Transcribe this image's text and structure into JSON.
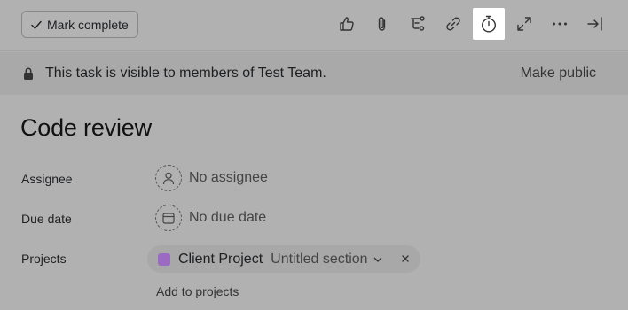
{
  "toolbar": {
    "mark_complete_label": "Mark complete",
    "icons": [
      "like-icon",
      "attachment-icon",
      "subtask-icon",
      "link-icon",
      "timer-icon",
      "expand-icon",
      "more-icon",
      "close-pane-icon"
    ],
    "active_icon": "timer-icon"
  },
  "banner": {
    "text": "This task is visible to members of Test Team.",
    "action": "Make public"
  },
  "task": {
    "title": "Code review",
    "fields": {
      "assignee_label": "Assignee",
      "assignee_value": "No assignee",
      "due_date_label": "Due date",
      "due_date_value": "No due date",
      "projects_label": "Projects"
    },
    "project": {
      "name": "Client Project",
      "section": "Untitled section",
      "color": "#9b6bc4"
    },
    "add_projects": "Add to projects"
  },
  "colors": {
    "overlay_background": "#b1b1b1",
    "active_icon_background": "#ffffff"
  }
}
